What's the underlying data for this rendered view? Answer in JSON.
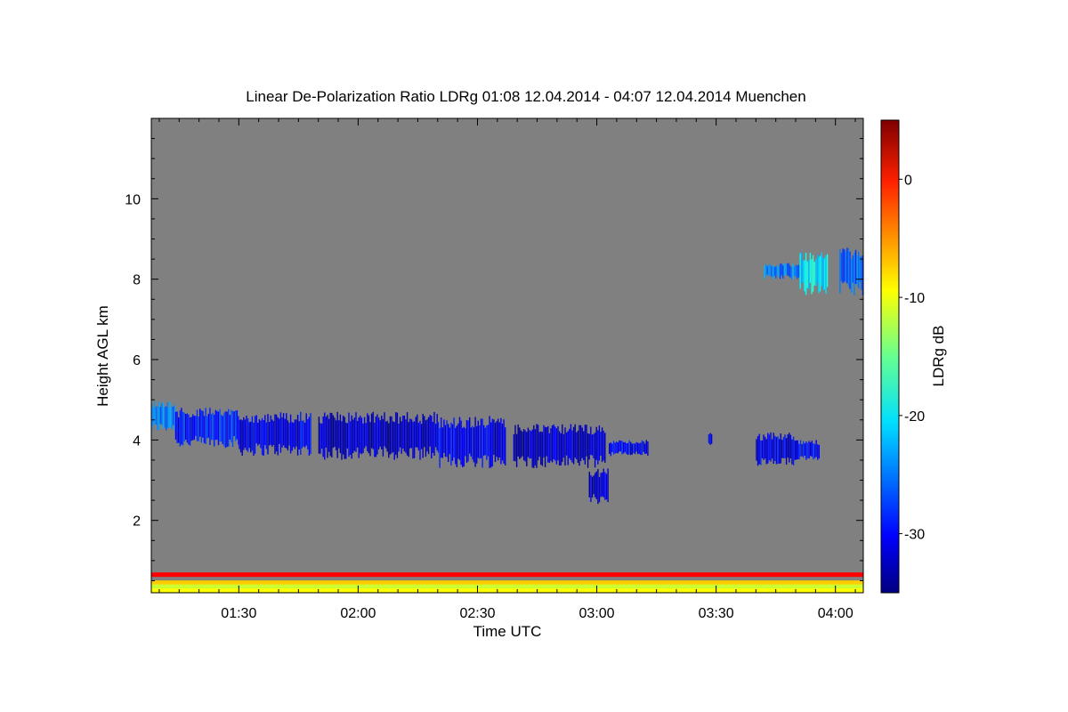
{
  "chart_data": {
    "type": "heatmap",
    "title": "Linear De-Polarization Ratio LDRg   01:08 12.04.2014 - 04:07 12.04.2014 Muenchen",
    "xlabel": "Time UTC",
    "ylabel": "Height AGL km",
    "colorbar_label": "LDRg dB",
    "x_range_minutes_utc": [
      68,
      247
    ],
    "x_ticks": [
      {
        "minute": 90,
        "label": "01:30"
      },
      {
        "minute": 120,
        "label": "02:00"
      },
      {
        "minute": 150,
        "label": "02:30"
      },
      {
        "minute": 180,
        "label": "03:00"
      },
      {
        "minute": 210,
        "label": "03:30"
      },
      {
        "minute": 240,
        "label": "04:00"
      }
    ],
    "ylim_km": [
      0.2,
      12.0
    ],
    "y_ticks": [
      {
        "value": 2,
        "label": "2"
      },
      {
        "value": 4,
        "label": "4"
      },
      {
        "value": 6,
        "label": "6"
      },
      {
        "value": 8,
        "label": "8"
      },
      {
        "value": 10,
        "label": "10"
      }
    ],
    "colorbar_range_db": [
      -35,
      5
    ],
    "colorbar_ticks": [
      {
        "value": 0,
        "label": "0"
      },
      {
        "value": -10,
        "label": "-10"
      },
      {
        "value": -20,
        "label": "-20"
      },
      {
        "value": -30,
        "label": "-30"
      }
    ],
    "background_color": "#808080",
    "colormap": "jet",
    "cloud_layers": [
      {
        "t_start": 68,
        "t_end": 74,
        "z_bottom": 4.2,
        "z_top": 5.0,
        "ldr": -25
      },
      {
        "t_start": 74,
        "t_end": 90,
        "z_bottom": 3.8,
        "z_top": 4.8,
        "ldr": -29
      },
      {
        "t_start": 90,
        "t_end": 108,
        "z_bottom": 3.6,
        "z_top": 4.7,
        "ldr": -31
      },
      {
        "t_start": 110,
        "t_end": 140,
        "z_bottom": 3.5,
        "z_top": 4.7,
        "ldr": -32
      },
      {
        "t_start": 140,
        "t_end": 157,
        "z_bottom": 3.3,
        "z_top": 4.6,
        "ldr": -31
      },
      {
        "t_start": 159,
        "t_end": 182,
        "z_bottom": 3.3,
        "z_top": 4.4,
        "ldr": -32
      },
      {
        "t_start": 178,
        "t_end": 183,
        "z_bottom": 2.4,
        "z_top": 3.3,
        "ldr": -32
      },
      {
        "t_start": 183,
        "t_end": 193,
        "z_bottom": 3.6,
        "z_top": 4.0,
        "ldr": -30
      },
      {
        "t_start": 208,
        "t_end": 209,
        "z_bottom": 3.8,
        "z_top": 4.2,
        "ldr": -30
      },
      {
        "t_start": 220,
        "t_end": 230,
        "z_bottom": 3.3,
        "z_top": 4.2,
        "ldr": -31
      },
      {
        "t_start": 230,
        "t_end": 236,
        "z_bottom": 3.5,
        "z_top": 4.0,
        "ldr": -30
      }
    ],
    "cirrus_layers": [
      {
        "t_start": 222,
        "t_end": 231,
        "z_bottom": 8.0,
        "z_top": 8.4,
        "ldr": -25
      },
      {
        "t_start": 231,
        "t_end": 238,
        "z_bottom": 7.6,
        "z_top": 8.7,
        "ldr": -21
      },
      {
        "t_start": 241,
        "t_end": 247,
        "z_bottom": 7.6,
        "z_top": 8.8,
        "ldr": -26
      }
    ],
    "near_ground_bands": [
      {
        "z": 0.65,
        "ldr": 0
      },
      {
        "z": 0.45,
        "ldr": -8
      },
      {
        "z": 0.35,
        "ldr": -12
      },
      {
        "z": 0.25,
        "ldr": -10
      }
    ]
  }
}
